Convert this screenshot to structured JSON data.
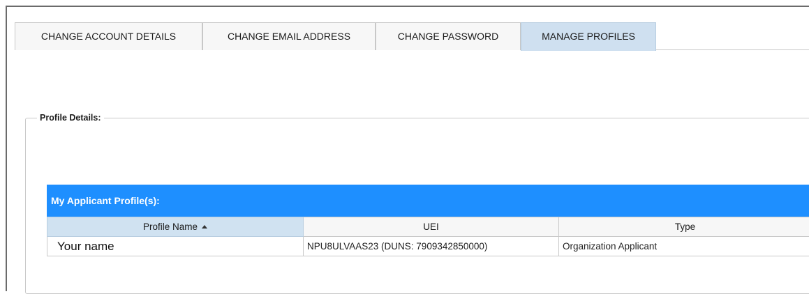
{
  "tabs": [
    {
      "label": "CHANGE ACCOUNT DETAILS",
      "active": false
    },
    {
      "label": "CHANGE EMAIL ADDRESS",
      "active": false
    },
    {
      "label": "CHANGE PASSWORD",
      "active": false
    },
    {
      "label": "MANAGE PROFILES",
      "active": true
    }
  ],
  "profile_details": {
    "legend": "Profile Details:"
  },
  "applicant_profiles": {
    "caption": "My Applicant Profile(s):",
    "columns": {
      "profile_name": "Profile Name",
      "uei": "UEI",
      "type": "Type"
    },
    "sort": {
      "column": "profile_name",
      "direction": "ascending",
      "icon": "sort-up-icon"
    },
    "rows": [
      {
        "profile_name": "Your name",
        "uei": "NPU8ULVAAS23 (DUNS: 7909342850000)",
        "type": "Organization Applicant"
      }
    ]
  },
  "colors": {
    "caption_bar": "#1e8fff",
    "active_tab": "#cfe0f0",
    "border": "#c8c8c8"
  }
}
